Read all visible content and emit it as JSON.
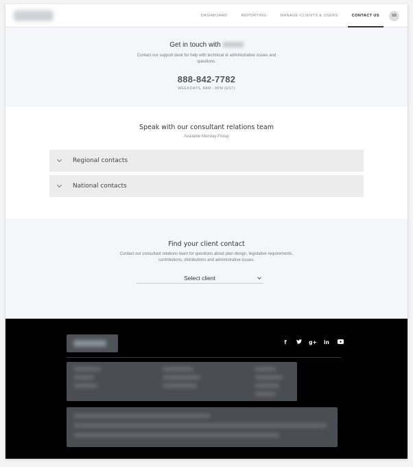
{
  "header": {
    "nav": [
      {
        "label": "DASHBOARD",
        "active": false
      },
      {
        "label": "REPORTING",
        "active": false
      },
      {
        "label": "MANAGE CLIENTS & USERS",
        "active": false
      },
      {
        "label": "CONTACT US",
        "active": true
      }
    ],
    "avatar_initials": "SB"
  },
  "support": {
    "title": "Get in touch with",
    "description": "Contact our support desk for help with technical or administrative issues and questions.",
    "phone": "888-842-7782",
    "hours": "WEEKDAYS, 8AM - 8PM (EST)"
  },
  "consultant": {
    "title": "Speak with our consultant relations team",
    "subtitle": "Available Monday-Friday",
    "sections": [
      {
        "label": "Regional contacts"
      },
      {
        "label": "National contacts"
      }
    ]
  },
  "client_contact": {
    "title": "Find your client contact",
    "description": "Contact our consultant relations team for questions about plan design, legislative requirements, contributions, distributions and administrative issues.",
    "select_value": "Select client"
  },
  "footer": {
    "social": [
      {
        "icon": "facebook-icon",
        "glyph": "f"
      },
      {
        "icon": "twitter-icon",
        "glyph": "🐦"
      },
      {
        "icon": "google-plus-icon",
        "glyph": "g+"
      },
      {
        "icon": "linkedin-icon",
        "glyph": "in"
      },
      {
        "icon": "youtube-icon",
        "glyph": "▶"
      }
    ]
  }
}
